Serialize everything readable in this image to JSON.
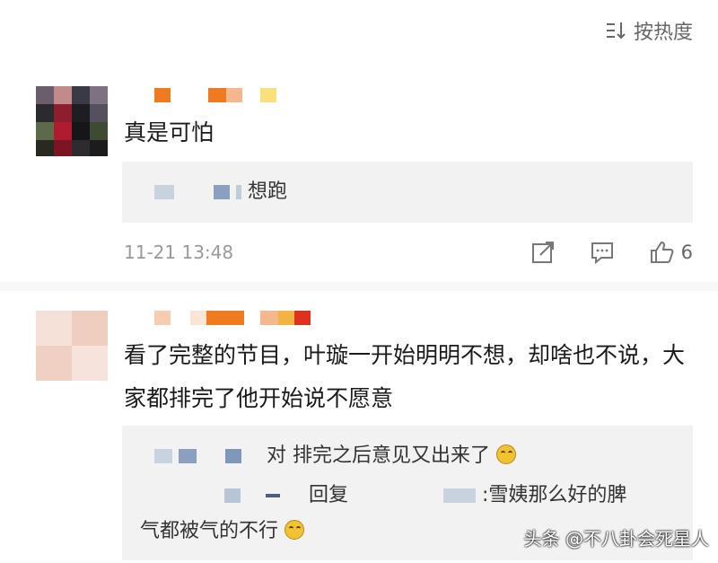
{
  "header": {
    "sort_label": "按热度"
  },
  "comments": [
    {
      "text": "真是可怕",
      "reply": {
        "text": "想跑"
      },
      "time": "11-21 13:48",
      "likes": "6"
    },
    {
      "text": "看了完整的节目，叶璇一开始明明不想，却啥也不说，大家都排完了他开始说不愿意",
      "replies": [
        {
          "text": "对 排完之后意见又出来了"
        },
        {
          "prefix": "回复",
          "text": ":雪姨那么好的脾",
          "continuation": "气都被气的不行"
        }
      ]
    }
  ],
  "watermark": "头条 @不八卦会死星人",
  "colors": {
    "accent": "#f07a1f",
    "meta_gray": "#999999",
    "reply_bg": "#f2f2f2"
  }
}
